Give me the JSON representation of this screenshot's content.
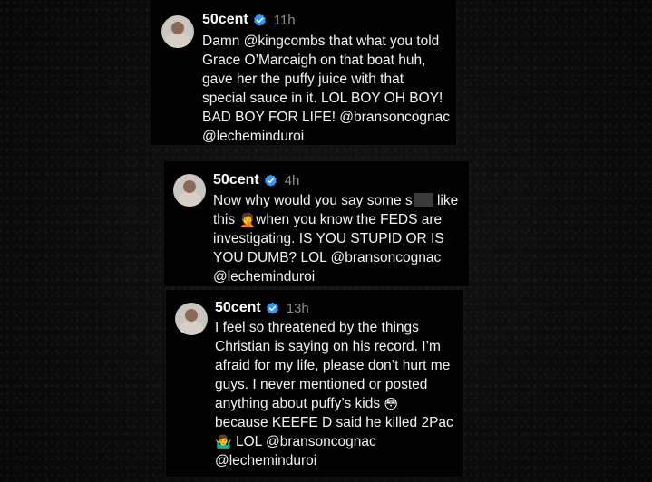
{
  "colors": {
    "background": "#0b0b0b",
    "card": "#010101",
    "verified_badge": "#3897f0",
    "timestamp": "#8e8e8e"
  },
  "comments": [
    {
      "username": "50cent",
      "verified": true,
      "time": "11h",
      "lines": [
        "Damn @kingcombs that what you told",
        "Grace O’Marcaigh on that boat huh,",
        "gave her the puffy juice with that",
        "special sauce in it. LOL BOY OH BOY!",
        "BAD BOY FOR LIFE! @bransoncognac",
        "@lecheminduroi"
      ]
    },
    {
      "username": "50cent",
      "verified": true,
      "time": "4h",
      "line1_before": "Now why would you say some s",
      "line1_after": " like",
      "line2_before": "this ",
      "line2_emoji": "🤦",
      "line2_after": "when you know the FEDS are",
      "lines_rest": [
        "investigating. IS YOU STUPID OR IS",
        "YOU DUMB? LOL @bransoncognac",
        "@lecheminduroi"
      ]
    },
    {
      "username": "50cent",
      "verified": true,
      "time": "13h",
      "lines": [
        "I feel so threatened by the things",
        "Christian is saying on his record. I’m",
        "afraid for my life, please don’t hurt me",
        "guys. I never mentioned or posted"
      ],
      "line5_before": "anything about puffy’s kids ",
      "line5_emoji": "😳",
      "line6": "because KEEFE D said he killed 2Pac",
      "line7_emoji": "🤷‍♂️",
      "line7_after": " LOL @bransoncognac",
      "line8": "@lecheminduroi"
    }
  ]
}
